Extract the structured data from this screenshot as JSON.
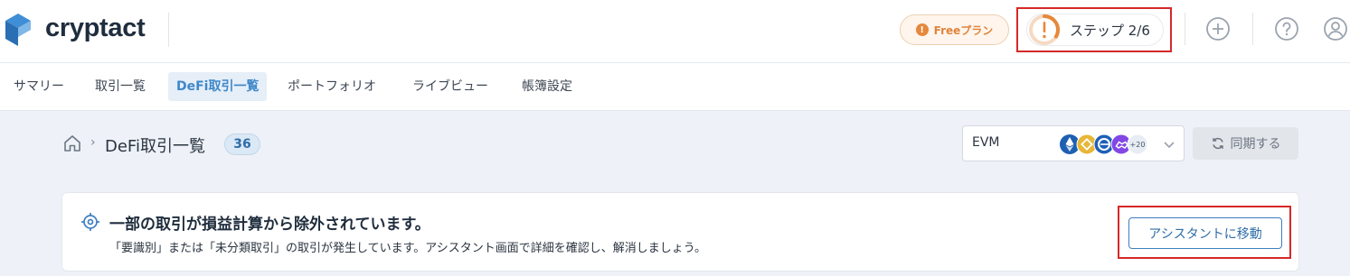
{
  "header": {
    "brand": "cryptact",
    "plan_label": "Freeプラン",
    "step_label": "ステップ 2/6",
    "step_progress": 0.333,
    "icons": [
      "plus-circle-icon",
      "help-circle-icon",
      "user-circle-icon"
    ]
  },
  "nav": {
    "items": [
      {
        "label": "サマリー"
      },
      {
        "label": "取引一覧"
      },
      {
        "label": "DeFi取引一覧",
        "active": true
      },
      {
        "label": "ポートフォリオ"
      },
      {
        "label": "ライブビュー"
      },
      {
        "label": "帳簿設定"
      }
    ]
  },
  "page": {
    "breadcrumb_sep": "›",
    "title": "DeFi取引一覧",
    "count": "36",
    "chain_select": {
      "value": "EVM",
      "more_badge": "+20",
      "chain_icons": [
        "ethereum-icon",
        "bnb-icon",
        "celo-icon",
        "polygon-icon"
      ]
    },
    "sync_label": "同期する"
  },
  "alert": {
    "title": "一部の取引が損益計算から除外されています。",
    "description": "「要識別」または「未分類取引」の取引が発生しています。アシスタント画面で詳細を確認し、解消しましょう。",
    "button_label": "アシスタントに移動"
  },
  "colors": {
    "accent": "#3e88c9",
    "warning": "#e6883c",
    "highlight_box": "#d62828",
    "page_bg": "#eef2f8"
  }
}
